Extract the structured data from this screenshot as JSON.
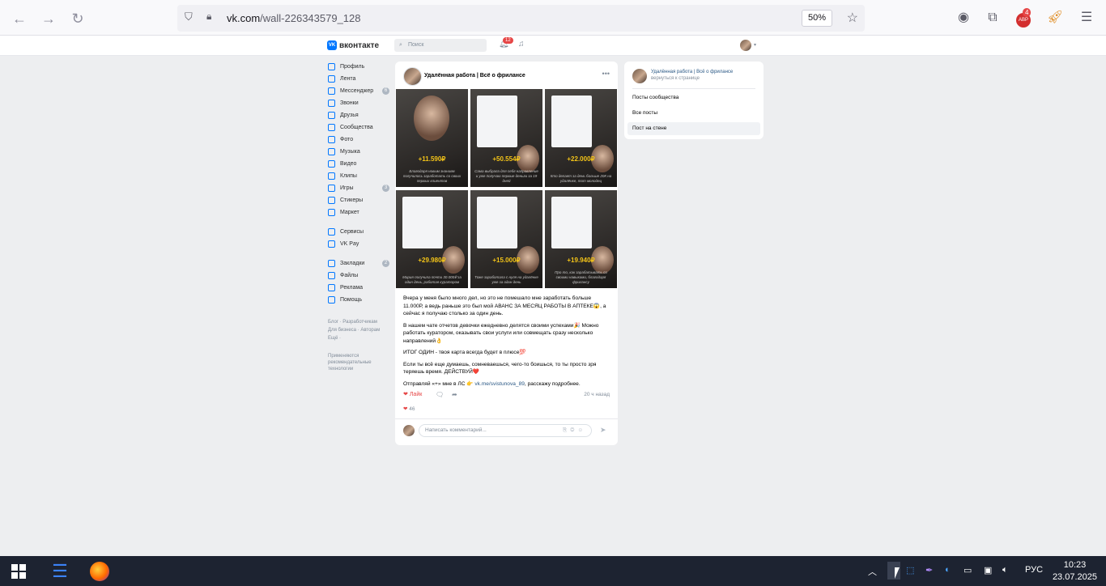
{
  "browser": {
    "url_host": "vk.com",
    "url_path": "/wall-226343579_128",
    "zoom": "50%",
    "extension_badge": "4",
    "abp_label": "ABP"
  },
  "vk": {
    "logo_text": "вконтакте",
    "search_placeholder": "Поиск",
    "notif_count": "12"
  },
  "left_nav": {
    "items": [
      {
        "label": "Профиль"
      },
      {
        "label": "Лента"
      },
      {
        "label": "Мессенджер",
        "count": "6"
      },
      {
        "label": "Звонки"
      },
      {
        "label": "Друзья"
      },
      {
        "label": "Сообщества"
      },
      {
        "label": "Фото"
      },
      {
        "label": "Музыка"
      },
      {
        "label": "Видео"
      },
      {
        "label": "Клипы"
      },
      {
        "label": "Игры",
        "count": "3"
      },
      {
        "label": "Стикеры"
      },
      {
        "label": "Маркет"
      }
    ],
    "items2": [
      {
        "label": "Сервисы"
      },
      {
        "label": "VK Pay"
      }
    ],
    "items3": [
      {
        "label": "Закладки",
        "count": "2"
      },
      {
        "label": "Файлы"
      },
      {
        "label": "Реклама"
      },
      {
        "label": "Помощь"
      }
    ],
    "footer_line1": "Блог · Разработчикам",
    "footer_line2": "Для бизнеса · Авторам",
    "footer_line3": "Ещё ·",
    "footer_note": "Применяются рекомендательные технологии"
  },
  "post": {
    "author": "Удалённая работа | Всё о фрилансе",
    "tiles": [
      {
        "amount": "+11.590₽",
        "caption": "Благодаря новым знаниям получилось заработать со своих первых клиентов"
      },
      {
        "amount": "+50.554₽",
        "caption": "Сама выбрала для себя направление и уже получаю первые деньги за 19 дней"
      },
      {
        "amount": "+22.000₽",
        "caption": "Кто делает за день больше 20К на удалёнке, тот молодец"
      },
      {
        "amount": "+29.980₽",
        "caption": "Мария получила почти 30.000₽ за один день, работая куратором"
      },
      {
        "amount": "+15.000₽",
        "caption": "Тоже заработала с нуля на удалёнке уже за один день"
      },
      {
        "amount": "+19.940₽",
        "caption": "Про то, как зарабатывать со своими навыками, благодаря фрилансу"
      }
    ],
    "paragraphs": [
      "Вчера у меня было много дел, но это не помешало мне заработать больше 11.000Р, а ведь раньше это был мой АВАНС ЗА МЕСЯЦ РАБОТЫ В АПТЕКЕ😱, а сейчас я получаю столько за один день.",
      "В нашем чате отчетов девочки ежедневно делятся своими успехами🎉 Можно работать куратором, оказывать свои услуги или совмещать сразу несколько направлений👌",
      "ИТОГ ОДИН - твоя карта всегда будет в плюсе💯",
      "Если ты всё еще думаешь, сомневаешься, чего-то боишься, то ты просто зря теряешь время. ДЕЙСТВУЙ❤️"
    ],
    "last_prefix": "Отправляй «+» мне в ЛС 👉",
    "last_link": "vk.me/svistunova_89",
    "last_suffix": ", расскажу подробнее.",
    "like_label": "Лайк",
    "time": "20 ч назад",
    "likes": "46",
    "comment_placeholder": "Написать комментарий..."
  },
  "right_card": {
    "title": "Удалённая работа | Всё о фрилансе",
    "subtitle": "вернуться к странице",
    "items": [
      {
        "label": "Посты сообщества"
      },
      {
        "label": "Все посты"
      },
      {
        "label": "Пост на стене"
      }
    ]
  },
  "taskbar": {
    "lang": "РУС",
    "time": "10:23",
    "date": "23.07.2025"
  }
}
